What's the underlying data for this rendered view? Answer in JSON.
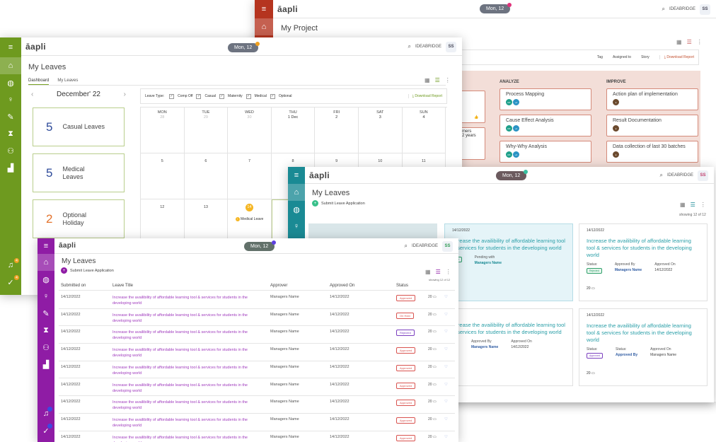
{
  "brand": {
    "logo": "āapli",
    "workspace": "IDEABRIDGE",
    "avatar": "SS",
    "date": "Mon, 12"
  },
  "project": {
    "title": "My Project",
    "toolbar": {
      "tag": "Tag",
      "assigned_to": "Assigned to",
      "story": "Story",
      "download": "Download Report"
    },
    "phases": [
      {
        "name": "",
        "cards": [
          {
            "title": ""
          },
          {
            "title": "mers\n2 years"
          }
        ]
      },
      {
        "name": "ANALYZE",
        "cards": [
          {
            "title": "Process Mapping"
          },
          {
            "title": "Cause Effect Analysis"
          },
          {
            "title": "Why-Why Analysis"
          }
        ]
      },
      {
        "name": "IMPROVE",
        "cards": [
          {
            "title": "Action plan of implementation"
          },
          {
            "title": "Result Documentation"
          },
          {
            "title": "Data collection of last 30 batches"
          }
        ]
      }
    ]
  },
  "dashboard": {
    "title": "My Leaves",
    "tabs": [
      "Dashboard",
      "My Leaves"
    ],
    "month": "December' 22",
    "balances": [
      {
        "count": "5",
        "label": "Casual Leaves",
        "color": "#2e4b9a"
      },
      {
        "count": "5",
        "label": "Medical Leaves",
        "color": "#2e4b9a"
      },
      {
        "count": "2",
        "label": "Optional Holiday",
        "color": "#e3722b"
      }
    ],
    "filter": {
      "label": "Leave Type:",
      "types": [
        "Comp Off",
        "Casual",
        "Maternity",
        "Medical",
        "Optional"
      ],
      "download": "Download Report"
    },
    "calendar": {
      "weekdays": [
        "MON",
        "TUE",
        "WED",
        "THU",
        "FRI",
        "SAT",
        "SUN"
      ],
      "row1": [
        {
          "d": "28",
          "dim": true
        },
        {
          "d": "29",
          "dim": true
        },
        {
          "d": "30",
          "dim": true
        },
        {
          "d": "1 Dec",
          "dim": false
        },
        {
          "d": "2",
          "dim": false
        },
        {
          "d": "3",
          "dim": false
        },
        {
          "d": "4",
          "dim": false
        }
      ],
      "row2": [
        "5",
        "6",
        "7",
        "8",
        "9",
        "10",
        "11"
      ],
      "row3": [
        "12",
        "13",
        "14",
        "",
        "",
        "",
        ""
      ],
      "event": "Medical Leave"
    }
  },
  "cards_view": {
    "title": "My Leaves",
    "submit": "Submit Leave Application",
    "showing": "showing 12 of 12",
    "cards": [
      {
        "date": "14/12/2022",
        "title": "Increase the availibility of affordable learning tool & services for students in the developing world",
        "f1": "Status:",
        "f2": "Approved By",
        "f3": "Approved On",
        "v2": "Managers Name",
        "v3": "14/12/2022",
        "badge": "Rejected",
        "comments": "20"
      },
      {
        "date": "14/12/2022",
        "title": "Increase the availibility of affordable learning tool & services for students in the developing world",
        "f1": "Status:",
        "f2": "Approved By",
        "f3": "Approved On",
        "v2": "Managers Name",
        "v3": "14/12/2022",
        "badge": "Approved",
        "comments": "20"
      },
      {
        "date": "14/12/2022",
        "title": "Increase the availibility of affordable learning tool & services for students in the developing world",
        "f1": "Status:",
        "f2": "Status:",
        "f3": "Approved On",
        "v2": "Approved By",
        "v3": "Managers Name",
        "badge": "Approved",
        "comments": "20"
      }
    ],
    "left_top": {
      "date": "14/12/2022",
      "title": "ncrease the availibility of affordable learning tool & services for students in the developing world",
      "f2": "Pending with",
      "v2": "Managers Name",
      "badge": "ved"
    },
    "left_bottom": {
      "title": "ncrease the availibility of affordable learning tool & services for students in the developing world",
      "f2": "Approved By",
      "f3": "Approved On",
      "v2": "Managers Name",
      "v3": "14/12/2022"
    }
  },
  "list_view": {
    "title": "My Leaves",
    "submit": "Submit Leave Application",
    "showing": "showing 12 of 12",
    "headers": [
      "Submitted on",
      "Leave Title",
      "Approver",
      "Approved On",
      "Status"
    ],
    "rows": [
      {
        "date": "14/12/2022",
        "title": "Increase the availibility of affordable learning tool & services for students in the developing world",
        "approver": "Managers Name",
        "approved_on": "14/12/2022",
        "status": "Approved",
        "comments": "20"
      },
      {
        "date": "14/12/2022",
        "title": "Increase the availibility of affordable learning tool & services for students in the developing world",
        "approver": "Managers Name",
        "approved_on": "14/12/2022",
        "status": "On Hold",
        "comments": "20"
      },
      {
        "date": "14/12/2022",
        "title": "Increase the availibility of affordable learning tool & services for students in the developing world",
        "approver": "Managers Name",
        "approved_on": "14/12/2022",
        "status": "Rejected",
        "comments": "20"
      },
      {
        "date": "14/12/2022",
        "title": "Increase the availibility of affordable learning tool & services for students in the developing world",
        "approver": "Managers Name",
        "approved_on": "14/12/2022",
        "status": "Approved",
        "comments": "20"
      },
      {
        "date": "14/12/2022",
        "title": "Increase the availibility of affordable learning tool & services for students in the developing world",
        "approver": "Managers Name",
        "approved_on": "14/12/2022",
        "status": "Approved",
        "comments": "20"
      },
      {
        "date": "14/12/2022",
        "title": "Increase the availibility of affordable learning tool & services for students in the developing world",
        "approver": "Managers Name",
        "approved_on": "14/12/2022",
        "status": "Approved",
        "comments": "20"
      },
      {
        "date": "14/12/2022",
        "title": "Increase the availibility of affordable learning tool & services for students in the developing world",
        "approver": "Managers Name",
        "approved_on": "14/12/2022",
        "status": "Approved",
        "comments": "20"
      },
      {
        "date": "14/12/2022",
        "title": "Increase the availibility of affordable learning tool & services for students in the developing world",
        "approver": "Managers Name",
        "approved_on": "14/12/2022",
        "status": "Approved",
        "comments": "20"
      },
      {
        "date": "14/12/2022",
        "title": "Increase the availibility of affordable learning tool & services for students in the developing world",
        "approver": "Managers Name",
        "approved_on": "14/12/2022",
        "status": "Approved",
        "comments": "20"
      }
    ]
  },
  "colors": {
    "project_side": "#b5341f",
    "dashboard_side": "#6e9a1f",
    "cards_side": "#1a8a94",
    "list_side": "#8f1ca5",
    "approved": "#d9534f",
    "on_hold": "#d9534f",
    "rejected": "#7b3fbf"
  },
  "icons": {
    "menu": "menu-icon",
    "home": "home-icon",
    "search": "search-icon",
    "grid": "grid-view-icon",
    "list": "list-view-icon",
    "more": "more-icon",
    "bell": "bell-icon",
    "comment": "comment-icon",
    "heart": "heart-icon"
  }
}
